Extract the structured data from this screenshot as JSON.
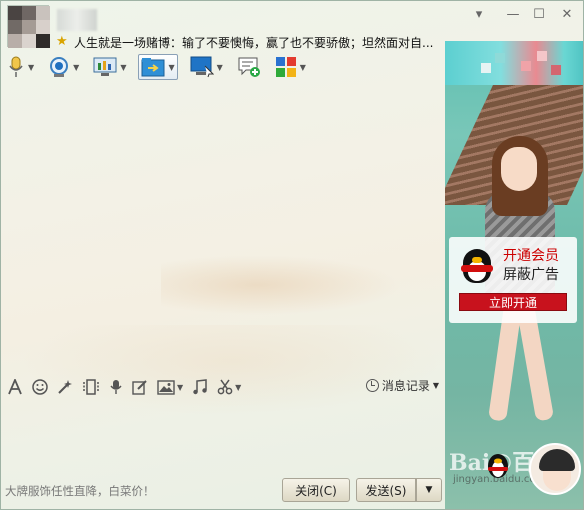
{
  "header": {
    "signature": "人生就是一场赌博：输了不要懊悔，赢了也不要骄傲；坦然面对自...",
    "window_controls": {
      "menu": "▾",
      "minimize": "—",
      "maximize": "☐",
      "close": "✕"
    }
  },
  "toolbar": {
    "items": [
      {
        "icon": "microphone-icon",
        "has_arrow": true
      },
      {
        "icon": "webcam-icon",
        "has_arrow": true
      },
      {
        "icon": "screen-share-icon",
        "has_arrow": true
      },
      {
        "icon": "file-transfer-icon",
        "has_arrow": true,
        "selected": true
      },
      {
        "icon": "remote-assist-icon",
        "has_arrow": true
      },
      {
        "icon": "group-chat-icon",
        "has_arrow": false
      },
      {
        "icon": "apps-icon",
        "has_arrow": true
      }
    ]
  },
  "input_toolbar": {
    "items": [
      "font-icon",
      "emoji-icon",
      "magic-icon",
      "vibrate-icon",
      "voice-icon",
      "edit-icon",
      "image-icon",
      "music-icon",
      "scissors-icon"
    ],
    "history_label": "消息记录"
  },
  "footer": {
    "ad_text": "大牌服饰任性直降，白菜价！",
    "close_label": "关闭(C)",
    "send_label": "发送(S)"
  },
  "side_panel": {
    "vip_line1": "开通会员",
    "vip_line2": "屏蔽广告",
    "vip_button": "立即开通",
    "watermark": "Bai@百",
    "watermark_sub": "jingyan.baidu.com"
  },
  "colors": {
    "vip_button": "#c8121d",
    "accent": "#d20f0f"
  }
}
